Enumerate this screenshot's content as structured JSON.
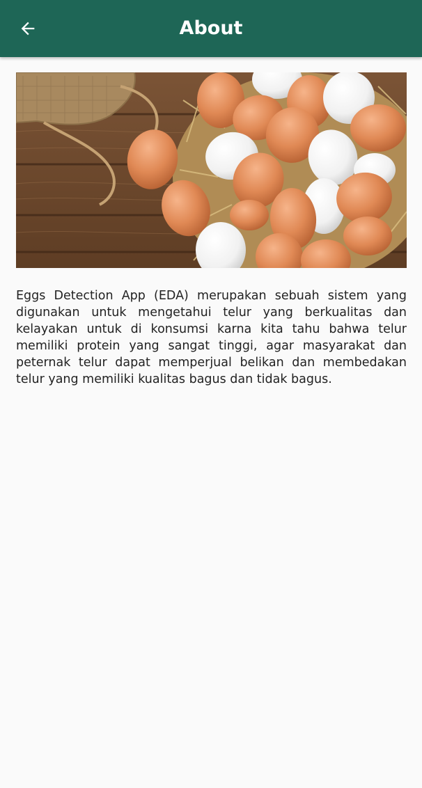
{
  "header": {
    "title": "About",
    "back_icon": "arrow-back-icon",
    "background_color": "#1e6656"
  },
  "hero_image": {
    "subject": "brown-and-white-eggs-on-straw-with-burlap-sack"
  },
  "content": {
    "description": "Eggs Detection App (EDA) merupakan sebuah sistem yang digunakan untuk mengetahui telur yang berkualitas dan kelayakan untuk di konsumsi karna kita tahu bahwa telur memiliki protein yang sangat tinggi, agar masyarakat dan peternak telur dapat memperjual belikan dan membedakan telur yang memiliki kualitas bagus dan tidak bagus."
  }
}
